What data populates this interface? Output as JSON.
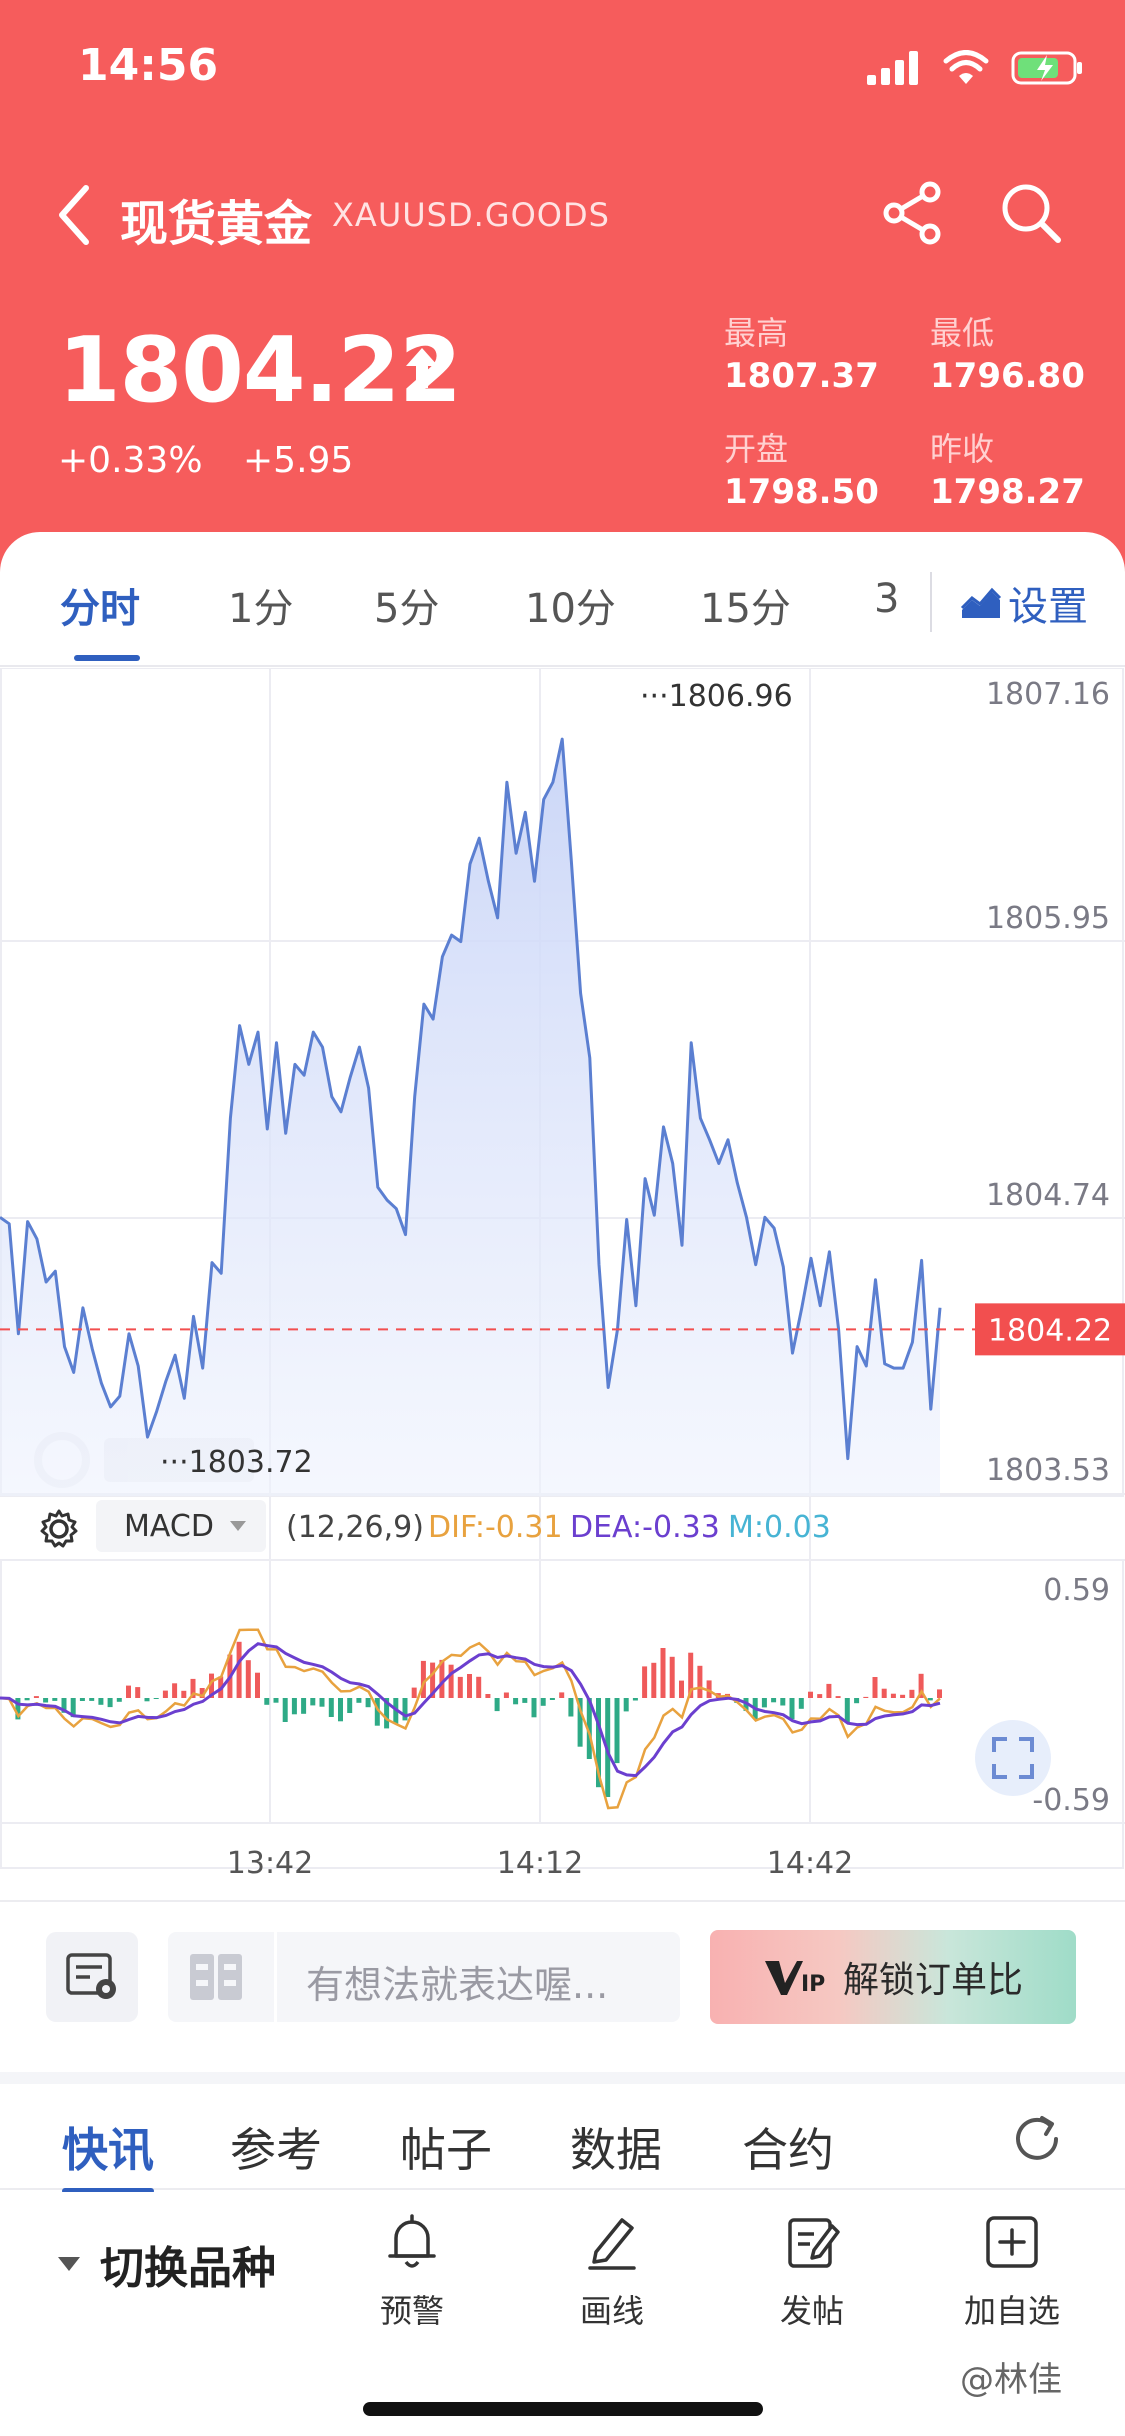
{
  "status": {
    "time": "14:56"
  },
  "nav": {
    "symbol_name": "现货黄金",
    "symbol_code": "XAUUSD.GOODS"
  },
  "quote": {
    "price": "1804.22",
    "change_pct": "+0.33%",
    "change_abs": "+5.95",
    "stats": [
      {
        "label": "最高",
        "value": "1807.37"
      },
      {
        "label": "最低",
        "value": "1796.80"
      },
      {
        "label": "开盘",
        "value": "1798.50"
      },
      {
        "label": "昨收",
        "value": "1798.27"
      }
    ]
  },
  "tabs": {
    "items": [
      "分时",
      "1分",
      "5分",
      "10分",
      "15分",
      "3"
    ],
    "settings": "设置"
  },
  "price_chart": {
    "y_axis": [
      "1807.16",
      "1805.95",
      "1804.74",
      "1803.53"
    ],
    "current_price_tag": "1804.22",
    "max_label": "1806.96",
    "min_label": "1803.72",
    "x_axis": [
      "13:42",
      "14:12",
      "14:42"
    ]
  },
  "macd": {
    "indicator": "MACD",
    "params": "(12,26,9)",
    "dif": "DIF:-0.31",
    "dea": "DEA:-0.33",
    "m": "M:0.03",
    "y_max": "0.59",
    "y_min": "-0.59"
  },
  "actions": {
    "comment_placeholder": "有想法就表达喔...",
    "vip_text": "解锁订单比"
  },
  "news_tabs": [
    "快讯",
    "参考",
    "帖子",
    "数据",
    "合约"
  ],
  "bottom_nav": {
    "switch": "切换品种",
    "items": [
      "预警",
      "画线",
      "发帖",
      "加自选"
    ],
    "watermark": "@林佳"
  },
  "colors": {
    "header_red": "#f65c5c",
    "accent_blue": "#2f5fbf",
    "line_blue": "#5b7fd1",
    "dif_orange": "#e8a23f",
    "dea_purple": "#6b3fcf",
    "bar_red": "#ef5a5a",
    "bar_green": "#2eaa86"
  },
  "chart_data": [
    {
      "type": "line",
      "title": "",
      "x_ticks": [
        "13:42",
        "14:12",
        "14:42"
      ],
      "y_ticks": [
        1807.16,
        1805.95,
        1804.74,
        1803.53
      ],
      "ylim": [
        1803.53,
        1807.16
      ],
      "reference_line": 1804.22,
      "series": [
        {
          "values": [
            1804.74,
            1804.71,
            1804.2,
            1804.72,
            1804.64,
            1804.44,
            1804.49,
            1804.14,
            1804.02,
            1804.32,
            1804.13,
            1803.97,
            1803.86,
            1803.91,
            1804.2,
            1804.05,
            1803.72,
            1803.84,
            1803.98,
            1804.1,
            1803.9,
            1804.28,
            1804.04,
            1804.53,
            1804.48,
            1805.2,
            1805.63,
            1805.45,
            1805.6,
            1805.15,
            1805.55,
            1805.13,
            1805.45,
            1805.4,
            1805.6,
            1805.53,
            1805.3,
            1805.23,
            1805.39,
            1805.53,
            1805.34,
            1804.88,
            1804.82,
            1804.78,
            1804.66,
            1805.3,
            1805.73,
            1805.66,
            1805.95,
            1806.05,
            1806.02,
            1806.38,
            1806.5,
            1806.3,
            1806.13,
            1806.76,
            1806.43,
            1806.62,
            1806.3,
            1806.68,
            1806.76,
            1806.96,
            1806.39,
            1805.78,
            1805.48,
            1804.52,
            1803.95,
            1804.22,
            1804.73,
            1804.33,
            1804.92,
            1804.75,
            1805.16,
            1804.99,
            1804.61,
            1805.55,
            1805.2,
            1805.1,
            1804.99,
            1805.1,
            1804.9,
            1804.74,
            1804.52,
            1804.74,
            1804.69,
            1804.51,
            1804.11,
            1804.32,
            1804.55,
            1804.33,
            1804.58,
            1804.22,
            1803.62,
            1804.14,
            1804.05,
            1804.45,
            1804.06,
            1804.04,
            1804.04,
            1804.16,
            1804.54,
            1803.85,
            1804.32
          ]
        }
      ]
    },
    {
      "type": "bar",
      "title": "MACD",
      "ylim": [
        -0.59,
        0.59
      ],
      "series": [
        {
          "name": "DIF",
          "last": -0.31
        },
        {
          "name": "DEA",
          "last": -0.33
        },
        {
          "name": "M",
          "last": 0.03
        }
      ]
    }
  ]
}
